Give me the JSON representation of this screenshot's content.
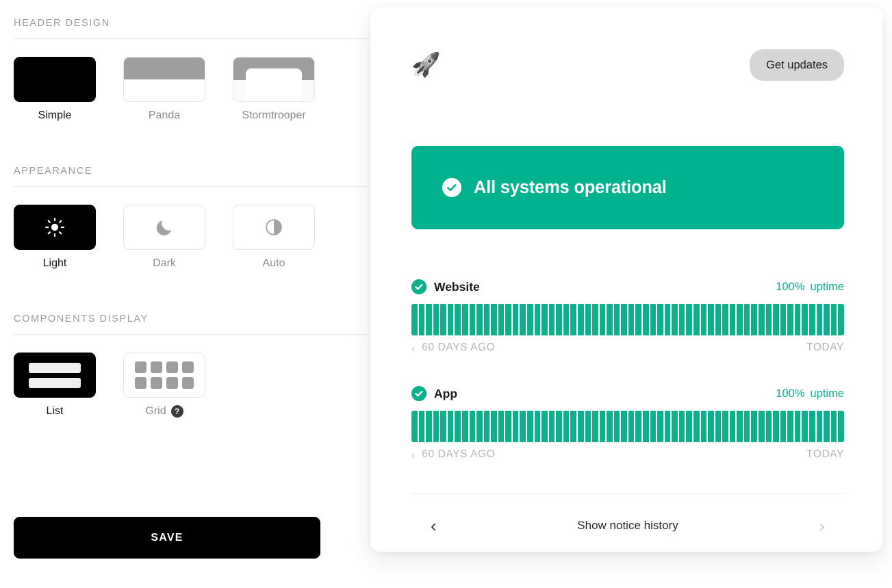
{
  "settings": {
    "sections": [
      {
        "id": "header-design",
        "title": "HEADER DESIGN",
        "options": [
          {
            "label": "Simple",
            "selected": true
          },
          {
            "label": "Panda",
            "selected": false
          },
          {
            "label": "Stormtrooper",
            "selected": false
          }
        ]
      },
      {
        "id": "appearance",
        "title": "APPEARANCE",
        "options": [
          {
            "label": "Light",
            "selected": true,
            "icon": "sun-icon"
          },
          {
            "label": "Dark",
            "selected": false,
            "icon": "moon-icon"
          },
          {
            "label": "Auto",
            "selected": false,
            "icon": "contrast-half-icon"
          }
        ]
      },
      {
        "id": "components-display",
        "title": "COMPONENTS DISPLAY",
        "options": [
          {
            "label": "List",
            "selected": true,
            "icon": "list-icon"
          },
          {
            "label": "Grid",
            "selected": false,
            "icon": "grid-icon",
            "badge": "?"
          }
        ]
      }
    ],
    "save_label": "SAVE"
  },
  "status_card": {
    "logo_icon": "space-shuttle-icon",
    "logo_glyph": "🚀",
    "get_updates_label": "Get updates",
    "banner": {
      "text": "All systems operational",
      "icon": "check-circle-icon",
      "color": "#00b28e"
    },
    "components": [
      {
        "name": "Website",
        "status_icon": "check-circle-icon",
        "uptime_percent": "100%",
        "uptime_word": "uptime",
        "timeline_start": "60 DAYS AGO",
        "timeline_end": "TODAY",
        "bars": 60,
        "bar_color": "#0cb08b"
      },
      {
        "name": "App",
        "status_icon": "check-circle-icon",
        "uptime_percent": "100%",
        "uptime_word": "uptime",
        "timeline_start": "60 DAYS AGO",
        "timeline_end": "TODAY",
        "bars": 60,
        "bar_color": "#0cb08b"
      }
    ],
    "footer": {
      "prev_icon": "chevron-left-icon",
      "label": "Show notice history",
      "next_icon": "chevron-right-icon"
    }
  },
  "colors": {
    "accent_teal": "#0cb08b",
    "banner_green": "#00b28e",
    "black": "#000000",
    "muted_gray": "#9a9a9a"
  }
}
